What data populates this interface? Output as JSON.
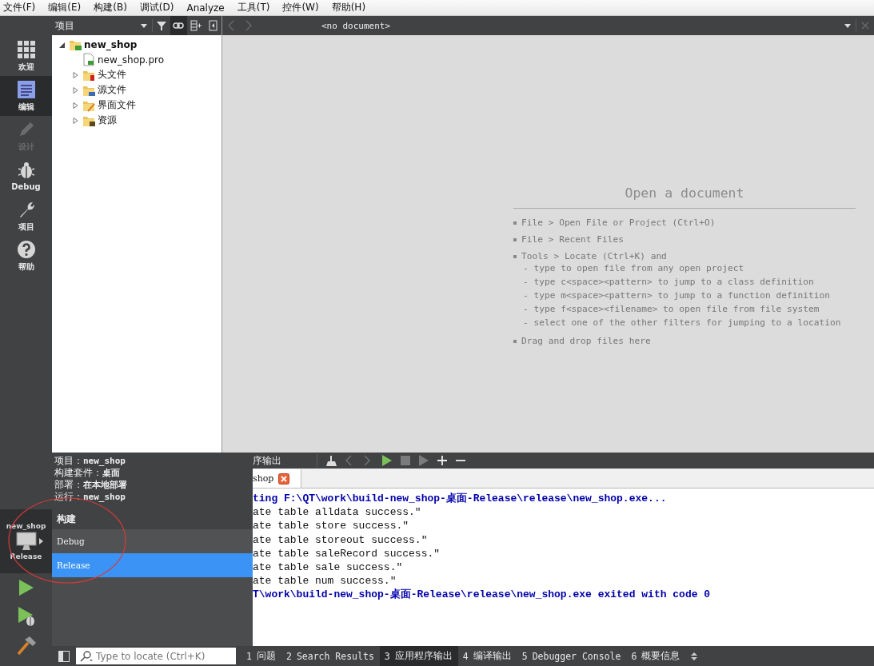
{
  "menu": [
    {
      "label": "文件(F)"
    },
    {
      "label": "编辑(E)"
    },
    {
      "label": "构建(B)"
    },
    {
      "label": "调试(D)"
    },
    {
      "label": "Analyze"
    },
    {
      "label": "工具(T)"
    },
    {
      "label": "控件(W)"
    },
    {
      "label": "帮助(H)"
    }
  ],
  "mode_bar": {
    "items": [
      {
        "label": "欢迎",
        "kind": "welcome",
        "selected": false,
        "disabled": false
      },
      {
        "label": "编辑",
        "kind": "edit",
        "selected": true,
        "disabled": false
      },
      {
        "label": "设计",
        "kind": "design",
        "selected": false,
        "disabled": true
      },
      {
        "label": "Debug",
        "kind": "debug",
        "selected": false,
        "disabled": false
      },
      {
        "label": "项目",
        "kind": "projects",
        "selected": false,
        "disabled": false
      },
      {
        "label": "帮助",
        "kind": "help",
        "selected": false,
        "disabled": false
      }
    ],
    "kit_selector": {
      "project": "new_shop",
      "build": "Release"
    },
    "actions": [
      {
        "kind": "run"
      },
      {
        "kind": "debug-run"
      },
      {
        "kind": "build"
      }
    ]
  },
  "project_panel": {
    "title": "项目",
    "tree": [
      {
        "label": "new_shop",
        "kind": "project",
        "expanded": true,
        "children": [
          {
            "label": "new_shop.pro",
            "kind": "pro-file"
          },
          {
            "label": "头文件",
            "kind": "headers",
            "expanded": false
          },
          {
            "label": "源文件",
            "kind": "sources",
            "expanded": false
          },
          {
            "label": "界面文件",
            "kind": "forms",
            "expanded": false
          },
          {
            "label": "资源",
            "kind": "resources",
            "expanded": false
          }
        ]
      }
    ]
  },
  "editor": {
    "document": "<no document>",
    "heading": "Open a document",
    "hints": [
      {
        "text": "File > Open File or Project (Ctrl+O)"
      },
      {
        "text": "File > Recent Files"
      },
      {
        "text": "Tools > Locate (Ctrl+K) and",
        "children": [
          {
            "text": "- type to open file from any open project"
          },
          {
            "text": "- type c<space><pattern> to jump to a class definition"
          },
          {
            "text": "- type m<space><pattern> to jump to a function definition"
          },
          {
            "text": "- type f<space><filename> to open file from file system"
          },
          {
            "text": "- select one of the other filters for jumping to a location"
          }
        ]
      },
      {
        "text": "Drag and drop files here"
      }
    ]
  },
  "kit_popup": {
    "info": [
      "项目：**new_shop**",
      "构建套件：**桌面**",
      "部署：**在本地部署**",
      "运行：**new_shop**"
    ],
    "section": "构建",
    "configs": [
      {
        "label": "Debug",
        "selected": false
      },
      {
        "label": "Release",
        "selected": true
      }
    ]
  },
  "output": {
    "title": "序输出",
    "tab": "shop",
    "lines": [
      {
        "text": "ting F:\\QT\\work\\build-new_shop-桌面-Release\\release\\new_shop.exe...",
        "kind": "info"
      },
      {
        "text": "ate table alldata success.\"",
        "kind": "plain"
      },
      {
        "text": "ate table store success.\"",
        "kind": "plain"
      },
      {
        "text": "ate table storeout success.\"",
        "kind": "plain"
      },
      {
        "text": "ate table saleRecord success.\"",
        "kind": "plain"
      },
      {
        "text": "ate table sale success.\"",
        "kind": "plain"
      },
      {
        "text": "ate table num success.\"",
        "kind": "plain"
      },
      {
        "text": "T\\work\\build-new_shop-桌面-Release\\release\\new_shop.exe exited with code 0",
        "kind": "info"
      }
    ]
  },
  "status_bar": {
    "search": {
      "placeholder": "Type to locate (Ctrl+K)"
    },
    "tabs": [
      {
        "number": "1",
        "label": "问题",
        "selected": false
      },
      {
        "number": "2",
        "label": "Search Results",
        "selected": false
      },
      {
        "number": "3",
        "label": "应用程序输出",
        "selected": true
      },
      {
        "number": "4",
        "label": "编译输出",
        "selected": false
      },
      {
        "number": "5",
        "label": "Debugger Console",
        "selected": false
      },
      {
        "number": "6",
        "label": "概要信息",
        "selected": false
      }
    ]
  },
  "annotations": [
    {
      "kind": "ellipse"
    }
  ]
}
